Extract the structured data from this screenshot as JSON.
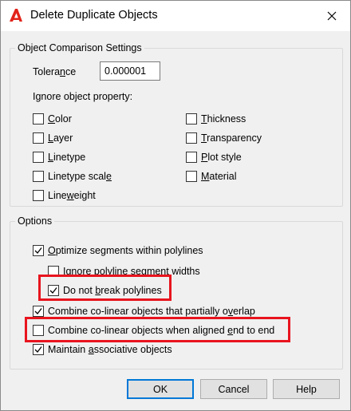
{
  "window": {
    "title": "Delete Duplicate Objects",
    "close_glyph": "✕"
  },
  "comparison": {
    "legend": "Object Comparison Settings",
    "tolerance_label_pre": "Tolera",
    "tolerance_label_u": "n",
    "tolerance_label_post": "ce",
    "tolerance_value": "0.000001",
    "ignore_label": "Ignore object property:",
    "properties": [
      {
        "pre": "",
        "u": "C",
        "post": "olor",
        "checked": false
      },
      {
        "pre": "",
        "u": "L",
        "post": "ayer",
        "checked": false
      },
      {
        "pre": "",
        "u": "L",
        "post": "inetype",
        "checked": false
      },
      {
        "pre": "Linetype scal",
        "u": "e",
        "post": "",
        "checked": false
      },
      {
        "pre": "Line",
        "u": "w",
        "post": "eight",
        "checked": false
      },
      {
        "pre": "",
        "u": "T",
        "post": "hickness",
        "checked": false
      },
      {
        "pre": "",
        "u": "T",
        "post": "ransparency",
        "checked": false
      },
      {
        "pre": "",
        "u": "P",
        "post": "lot style",
        "checked": false
      },
      {
        "pre": "",
        "u": "M",
        "post": "aterial",
        "checked": false
      }
    ]
  },
  "options": {
    "legend": "Options",
    "items": [
      {
        "pre": "",
        "u": "O",
        "post": "ptimize segments within polylines",
        "checked": true
      },
      {
        "pre": "",
        "u": "I",
        "post": "gnore polyline segment widths",
        "checked": false
      },
      {
        "pre": "Do not ",
        "u": "b",
        "post": "reak polylines",
        "checked": true
      },
      {
        "pre": "Combine co-linear objects that partially o",
        "u": "v",
        "post": "erlap",
        "checked": true
      },
      {
        "pre": "Combine co-linear objects when aligned ",
        "u": "e",
        "post": "nd to end",
        "checked": false
      },
      {
        "pre": "Maintain ",
        "u": "a",
        "post": "ssociative objects",
        "checked": true
      }
    ]
  },
  "buttons": {
    "ok": "OK",
    "cancel": "Cancel",
    "help": "Help"
  },
  "colors": {
    "highlight": "#e8141e",
    "app_icon": "#e2231a",
    "default_button_border": "#0078d7"
  },
  "icons": {
    "app": "autocad-a-icon",
    "close": "close-icon",
    "check": "checkmark-icon"
  }
}
